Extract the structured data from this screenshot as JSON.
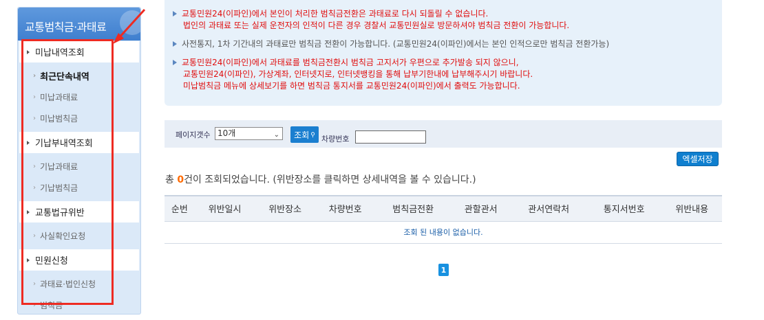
{
  "sidebar": {
    "title": "교통범칙금·과태료",
    "groups": [
      {
        "label": "미납내역조회",
        "items": [
          "최근단속내역",
          "미납과태료",
          "미납범칙금"
        ]
      },
      {
        "label": "기납부내역조회",
        "items": [
          "기납과태료",
          "기납범칙금"
        ]
      },
      {
        "label": "교통법규위반",
        "items": [
          "사실확인요청"
        ]
      },
      {
        "label": "민원신청",
        "items": [
          "과태료·법인신청",
          "범칙금"
        ]
      }
    ]
  },
  "notice": {
    "p1_line1": "교통민원24(이파인)에서 본인이 처리한 범칙금전환은 과태료로 다시 되돌릴 수 없습니다.",
    "p1_line2": "법인의 과태료 또는 실제 운전자의 인적이 다른 경우 경찰서 교통민원실로 방문하셔야 범칙금 전환이 가능합니다.",
    "p2": "사전통지, 1차 기간내의 과태료만 범칙금 전환이 가능합니다. (교통민원24(이파인)에서는 본인 인적으로만 범칙금 전환가능)",
    "p3_line1": "교통민원24(이파인)에서 과태료를 범칙금전환시 범칙금 고지서가 우편으로 추가발송 되지 않으니,",
    "p3_line2": "교통민원24(이파인), 가상계좌, 인터넷지로, 인터넷뱅킹을 통해 납부기한내에 납부해주시기 바랍니다.",
    "p3_line3": "미납범칙금 메뉴에 상세보기를 하면 범칙금 통지서를 교통민원24(이파인)에서 출력도 가능합니다."
  },
  "search": {
    "page_size_label": "페이지갯수",
    "page_size_value": "10개",
    "search_button": "조회",
    "car_number_label": "차량번호",
    "car_number_value": ""
  },
  "excel_button": "엑셀저장",
  "result": {
    "prefix": "총 ",
    "count": "0",
    "suffix": "건이 조회되었습니다. (위반장소를 클릭하면 상세내역을 볼 수 있습니다.)"
  },
  "table": {
    "headers": [
      "순번",
      "위반일시",
      "위반장소",
      "차량번호",
      "범칙금전환",
      "관할관서",
      "관서연락처",
      "통지서번호",
      "위반내용"
    ],
    "empty_message": "조회 된 내용이 없습니다."
  },
  "pagination": {
    "current": "1"
  },
  "colors": {
    "sidebar_header": "#4f8ed8",
    "annotation": "#ee2b22",
    "accent": "#1b7fd0",
    "notice_red": "#e00d0d"
  }
}
